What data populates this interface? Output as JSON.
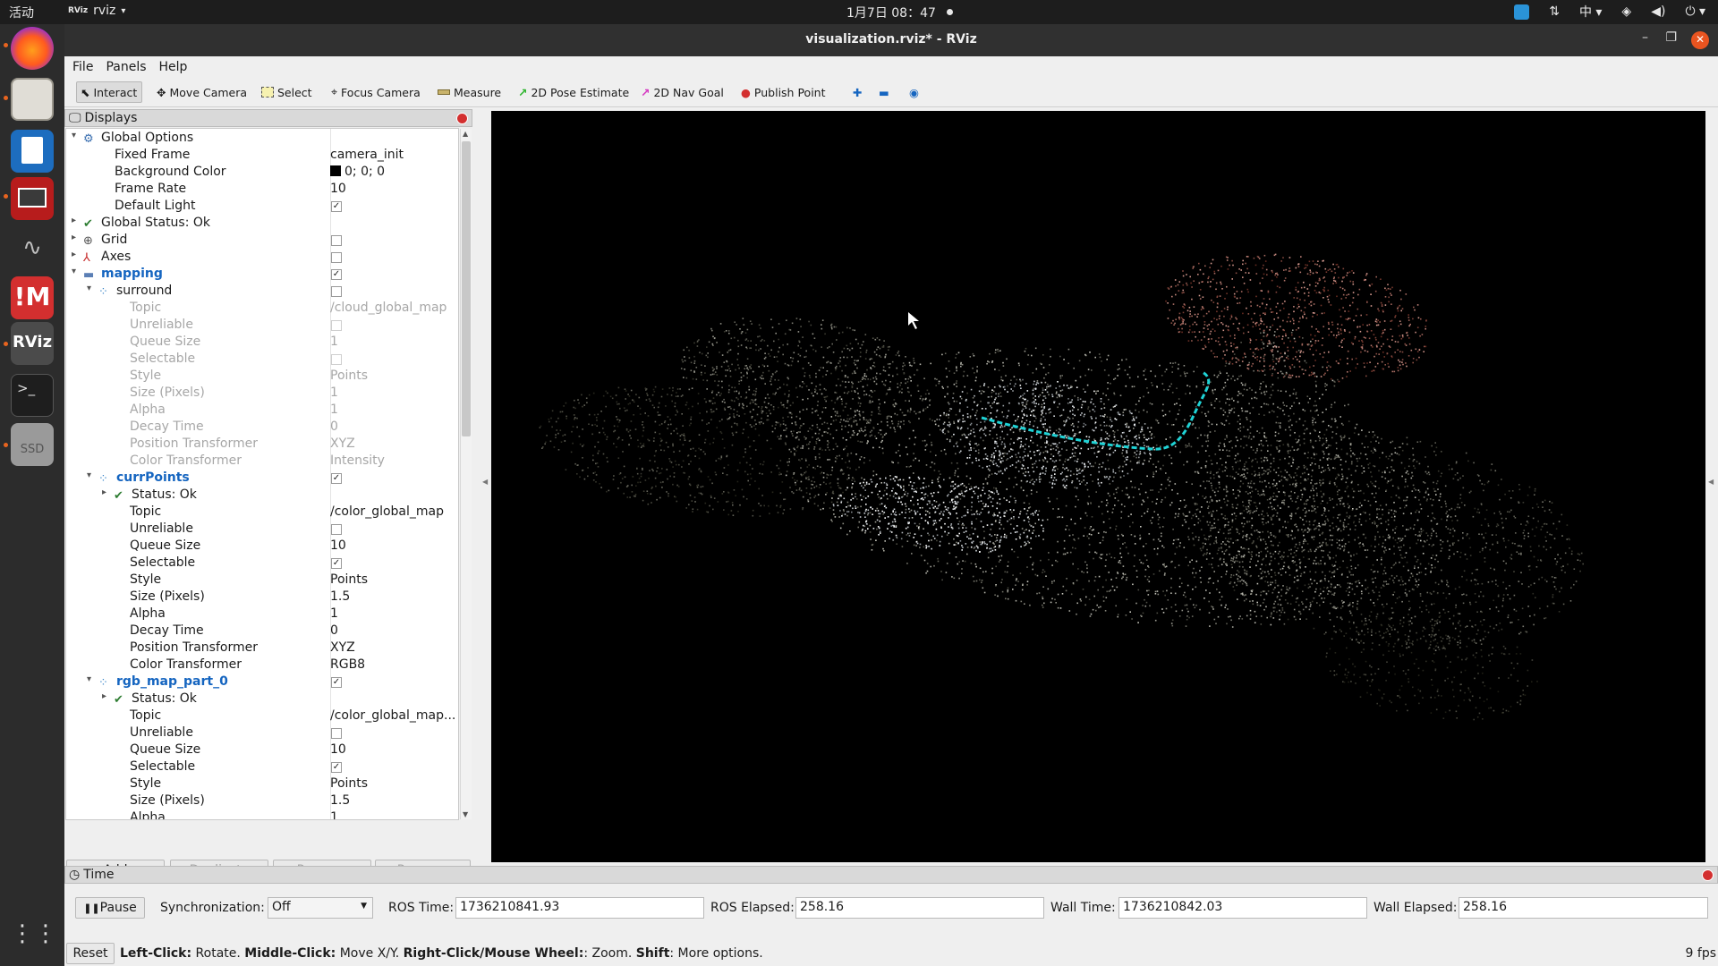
{
  "topbar": {
    "activities": "活动",
    "app_name": "rviz",
    "clock": "1月7日  08：47",
    "input_method": "中"
  },
  "window": {
    "title": "visualization.rviz* - RViz"
  },
  "menu": [
    "File",
    "Panels",
    "Help"
  ],
  "toolbar": {
    "interact": "Interact",
    "move_camera": "Move Camera",
    "select": "Select",
    "focus_camera": "Focus Camera",
    "measure": "Measure",
    "pose_estimate": "2D Pose Estimate",
    "nav_goal": "2D Nav Goal",
    "publish_point": "Publish Point"
  },
  "displays": {
    "title": "Displays",
    "rows": [
      {
        "name": "Global Options",
        "value": ""
      },
      {
        "name": "Fixed Frame",
        "value": "camera_init"
      },
      {
        "name": "Background Color",
        "value": "0; 0; 0"
      },
      {
        "name": "Frame Rate",
        "value": "10"
      },
      {
        "name": "Default Light",
        "value": ""
      },
      {
        "name": "Global Status: Ok",
        "value": ""
      },
      {
        "name": "Grid",
        "value": ""
      },
      {
        "name": "Axes",
        "value": ""
      },
      {
        "name": "mapping",
        "value": ""
      },
      {
        "name": "surround",
        "value": ""
      },
      {
        "name": "Topic",
        "value": "/cloud_global_map"
      },
      {
        "name": "Unreliable",
        "value": ""
      },
      {
        "name": "Queue Size",
        "value": "1"
      },
      {
        "name": "Selectable",
        "value": ""
      },
      {
        "name": "Style",
        "value": "Points"
      },
      {
        "name": "Size (Pixels)",
        "value": "1"
      },
      {
        "name": "Alpha",
        "value": "1"
      },
      {
        "name": "Decay Time",
        "value": "0"
      },
      {
        "name": "Position Transformer",
        "value": "XYZ"
      },
      {
        "name": "Color Transformer",
        "value": "Intensity"
      },
      {
        "name": "currPoints",
        "value": ""
      },
      {
        "name": "Status: Ok",
        "value": ""
      },
      {
        "name": "Topic",
        "value": "/color_global_map"
      },
      {
        "name": "Unreliable",
        "value": ""
      },
      {
        "name": "Queue Size",
        "value": "10"
      },
      {
        "name": "Selectable",
        "value": ""
      },
      {
        "name": "Style",
        "value": "Points"
      },
      {
        "name": "Size (Pixels)",
        "value": "1.5"
      },
      {
        "name": "Alpha",
        "value": "1"
      },
      {
        "name": "Decay Time",
        "value": "0"
      },
      {
        "name": "Position Transformer",
        "value": "XYZ"
      },
      {
        "name": "Color Transformer",
        "value": "RGB8"
      },
      {
        "name": "rgb_map_part_0",
        "value": ""
      },
      {
        "name": "Status: Ok",
        "value": ""
      },
      {
        "name": "Topic",
        "value": "/color_global_map..."
      },
      {
        "name": "Unreliable",
        "value": ""
      },
      {
        "name": "Queue Size",
        "value": "10"
      },
      {
        "name": "Selectable",
        "value": ""
      },
      {
        "name": "Style",
        "value": "Points"
      },
      {
        "name": "Size (Pixels)",
        "value": "1.5"
      },
      {
        "name": "Alpha",
        "value": "1"
      }
    ],
    "buttons": {
      "add": "Add",
      "duplicate": "Duplicate",
      "remove": "Remove",
      "rename": "Rename"
    }
  },
  "time": {
    "title": "Time",
    "pause": "Pause",
    "sync_label": "Synchronization:",
    "sync_value": "Off",
    "ros_time_label": "ROS Time:",
    "ros_time": "1736210841.93",
    "ros_elapsed_label": "ROS Elapsed:",
    "ros_elapsed": "258.16",
    "wall_time_label": "Wall Time:",
    "wall_time": "1736210842.03",
    "wall_elapsed_label": "Wall Elapsed:",
    "wall_elapsed": "258.16"
  },
  "status": {
    "reset": "Reset",
    "k1": "Left-Click:",
    "v1": " Rotate. ",
    "k2": "Middle-Click:",
    "v2": " Move X/Y. ",
    "k3": "Right-Click/Mouse Wheel:",
    "v3": ": Zoom. ",
    "k4": "Shift",
    "v4": ": More options.",
    "fps": "9 fps"
  },
  "dock": {
    "ssd_label": "SSD",
    "rviz_label": "RViz"
  },
  "colors": {
    "trajectory": "#1fd3d6",
    "accent": "#e95420"
  }
}
